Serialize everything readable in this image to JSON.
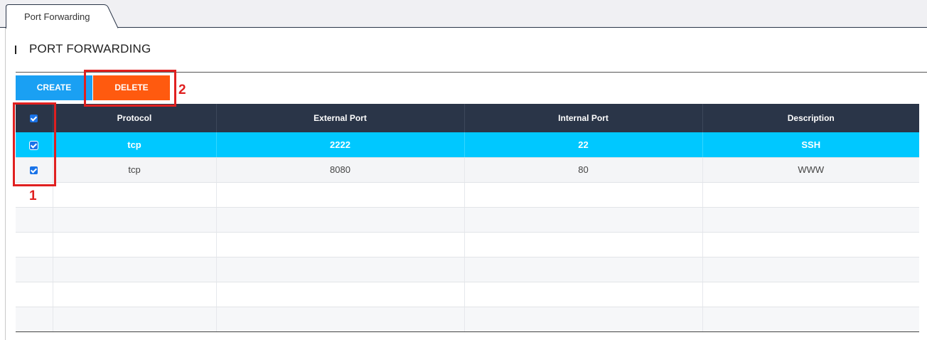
{
  "tabs": [
    {
      "label": "Port Forwarding",
      "active": true
    }
  ],
  "section": {
    "title": "PORT FORWARDING"
  },
  "toolbar": {
    "create_label": "CREATE",
    "delete_label": "DELETE"
  },
  "table": {
    "headers": [
      "Protocol",
      "External Port",
      "Internal Port",
      "Description"
    ],
    "rows": [
      {
        "protocol": "tcp",
        "external_port": "2222",
        "internal_port": "22",
        "description": "SSH",
        "checked": true,
        "highlighted": true
      },
      {
        "protocol": "tcp",
        "external_port": "8080",
        "internal_port": "80",
        "description": "WWW",
        "checked": true,
        "highlighted": false
      }
    ]
  },
  "annotations": {
    "label_1": "1",
    "label_2": "2",
    "color": "#e02020"
  },
  "colors": {
    "header_bg": "#2a3548",
    "selected_row": "#00c8ff",
    "create_button": "#1aa0f3",
    "delete_button": "#ff5a0f",
    "checkbox": "#1a73e8"
  }
}
